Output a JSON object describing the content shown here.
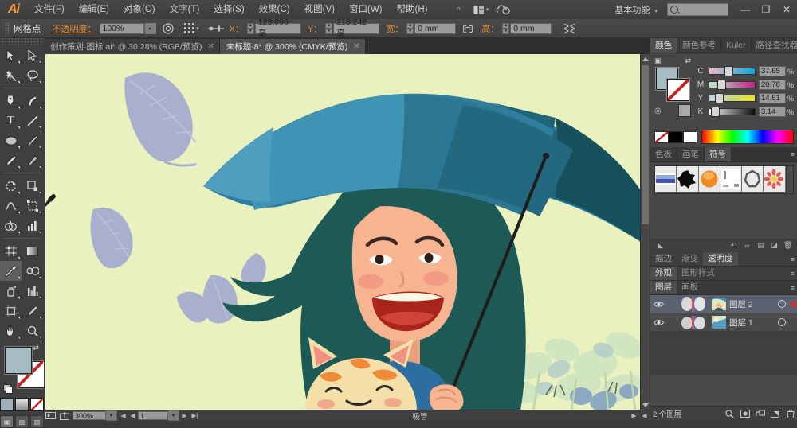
{
  "app": {
    "name": "Adobe Illustrator",
    "logo": "Ai"
  },
  "menubar": {
    "items": [
      "文件(F)",
      "编辑(E)",
      "对象(O)",
      "文字(T)",
      "选择(S)",
      "效果(C)",
      "视图(V)",
      "窗口(W)",
      "帮助(H)"
    ],
    "bridge_icon": "br-icon",
    "arrange_icon": "arrange-documents-icon",
    "cc_icon": "creative-cloud-icon",
    "workspace": "基本功能",
    "search_placeholder": "",
    "minimize": "—",
    "restore": "❐",
    "close": "✕"
  },
  "controlbar": {
    "selection_label": "网格点",
    "opacity_label": "不透明度：",
    "opacity_value": "100%",
    "recolor_icon": "recolor-artwork-icon",
    "transform_icon": "transform-reference-icon",
    "align_icon": "align-icon",
    "x_label": "X：",
    "x_value": "123.096 亳",
    "y_label": "Y：",
    "y_value": "218.242 亳",
    "w_label": "宽：",
    "w_value": "0 mm",
    "link_icon": "constrain-proportions-icon",
    "h_label": "高：",
    "h_value": "0 mm",
    "envelope_icon": "envelope-distort-icon"
  },
  "toolbar": {
    "tools": [
      {
        "name": "selection-tool",
        "glyph": "➤"
      },
      {
        "name": "direct-selection-tool",
        "glyph": "➤"
      },
      {
        "name": "magic-wand-tool",
        "glyph": "✦"
      },
      {
        "name": "lasso-tool",
        "glyph": "◯"
      },
      {
        "name": "pen-tool",
        "glyph": "✒"
      },
      {
        "name": "add-anchor-point-tool",
        "glyph": "✑"
      },
      {
        "name": "type-tool",
        "glyph": "T"
      },
      {
        "name": "line-segment-tool",
        "glyph": "／"
      },
      {
        "name": "ellipse-tool",
        "glyph": "⬭"
      },
      {
        "name": "paintbrush-tool",
        "glyph": "🖌"
      },
      {
        "name": "pencil-tool",
        "glyph": "✎"
      },
      {
        "name": "blob-brush-tool",
        "glyph": "◣"
      },
      {
        "name": "rotate-tool",
        "glyph": "↻"
      },
      {
        "name": "scale-tool",
        "glyph": "⊡"
      },
      {
        "name": "width-tool",
        "glyph": "∿"
      },
      {
        "name": "free-transform-tool",
        "glyph": "⬚"
      },
      {
        "name": "shape-builder-tool",
        "glyph": "◍"
      },
      {
        "name": "column-graph-tool",
        "glyph": "▥"
      },
      {
        "name": "mesh-tool",
        "glyph": "▩"
      },
      {
        "name": "gradient-tool",
        "glyph": "▤"
      },
      {
        "name": "eyedropper-tool",
        "glyph": "⟋",
        "selected": true
      },
      {
        "name": "blend-tool",
        "glyph": "◎"
      },
      {
        "name": "symbol-sprayer-tool",
        "glyph": "⌾"
      },
      {
        "name": "graph-tool",
        "glyph": "⅂⅂"
      },
      {
        "name": "artboard-tool",
        "glyph": "⊞"
      },
      {
        "name": "slice-tool",
        "glyph": "／"
      },
      {
        "name": "hand-tool",
        "glyph": "✋"
      },
      {
        "name": "zoom-tool",
        "glyph": "🔍"
      }
    ],
    "fill_color": "#a8bcc4",
    "stroke_color": "#ffffff",
    "screen_mode": "正常屏幕模式"
  },
  "document_tabs": [
    {
      "label": "创作策划·图标.ai* @ 30.28% (RGB/预览)",
      "active": false,
      "close": "✕"
    },
    {
      "label": "未标题-8* @ 300% (CMYK/预览)",
      "active": true,
      "close": "✕"
    }
  ],
  "statusbar": {
    "artboard_icon": "artboard-navigation-icon",
    "share_icon": "share-on-behance-icon",
    "zoom_level": "300%",
    "first_page": "|◀",
    "prev_page": "◀",
    "page_number": "1",
    "next_page": "▶",
    "last_page": "▶|",
    "tool_name": "吸管",
    "right_arrow": "▶",
    "left_arrow": "◀"
  },
  "panels": {
    "color": {
      "tabs": [
        {
          "label": "颜色",
          "active": true
        },
        {
          "label": "颜色参考",
          "active": false
        },
        {
          "label": "Kuler",
          "active": false
        },
        {
          "label": "路径查找器",
          "active": false
        }
      ],
      "channels": [
        {
          "label": "C",
          "value": "37.65",
          "unit": "%",
          "pct": 37.65
        },
        {
          "label": "M",
          "value": "20.78",
          "unit": "%",
          "pct": 20.78
        },
        {
          "label": "Y",
          "value": "14.51",
          "unit": "%",
          "pct": 14.51
        },
        {
          "label": "K",
          "value": "3.14",
          "unit": "%",
          "pct": 3.14
        }
      ],
      "fill_color": "#a8bcc4",
      "stroke_color": "#ffffff"
    },
    "symbols": {
      "tabs": [
        {
          "label": "色板",
          "active": false
        },
        {
          "label": "画笔",
          "active": false
        },
        {
          "label": "符号",
          "active": true
        }
      ],
      "items": [
        "gradient-swatch-symbol",
        "ink-splat-symbol",
        "orange-sphere-symbol",
        "corner-mark-symbol",
        "wreath-symbol",
        "red-flower-symbol"
      ]
    },
    "stroke_group": {
      "tabs": [
        {
          "label": "描边",
          "active": false
        },
        {
          "label": "渐变",
          "active": false
        },
        {
          "label": "透明度",
          "active": true
        }
      ]
    },
    "appearance_group": {
      "tabs": [
        {
          "label": "外观",
          "active": true
        },
        {
          "label": "图形样式",
          "active": false
        }
      ]
    },
    "layers": {
      "tabs": [
        {
          "label": "图层",
          "active": true
        },
        {
          "label": "画板",
          "active": false
        }
      ],
      "rows": [
        {
          "name": "图层 2",
          "visible": true,
          "selected": true,
          "has_target_dot": true
        },
        {
          "name": "图层 1",
          "visible": true,
          "selected": false,
          "has_target_dot": false
        }
      ],
      "footer_count": "2 个图层",
      "footer_icons": [
        "locate-object-icon",
        "make-clipping-mask-icon",
        "create-sublayer-icon",
        "create-new-layer-icon",
        "delete-selection-icon"
      ]
    }
  },
  "artwork": {
    "name": "girl-with-umbrella-illustration",
    "colors": {
      "background": "#e9f2bf",
      "leaf": "#a9b0cd",
      "umbrella_light": "#4f9ec0",
      "umbrella_mid": "#2f7e9e",
      "umbrella_dark": "#1e6578",
      "umbrella_darkest": "#16505c",
      "hair": "#1d5a55",
      "skin": "#f6b490",
      "blush": "#f0927f",
      "shirt": "#2d6da0",
      "mouth": "#a8241c",
      "cat_body": "#f4dfa8",
      "cat_stripe": "#f08b3a",
      "pole": "#1d1d1d",
      "flower_blue": "#5b7fc0",
      "flower_leaf": "#cfe0c0"
    }
  }
}
